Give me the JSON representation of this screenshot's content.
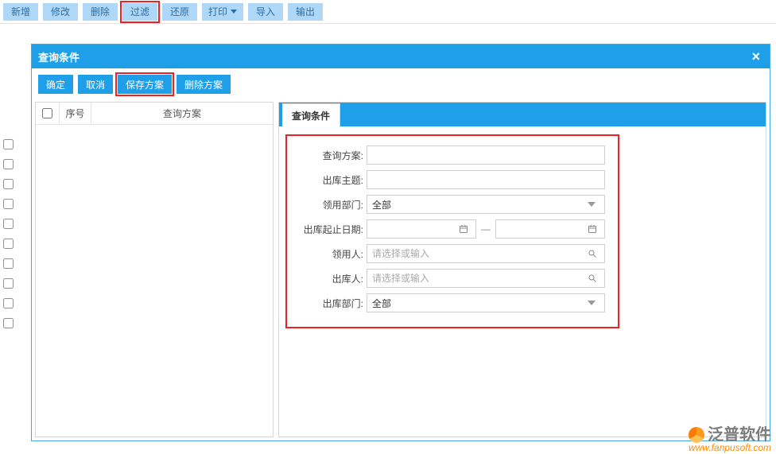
{
  "toolbar": {
    "buttons": [
      {
        "label": "新增",
        "name": "new-button",
        "caret": false,
        "highlight": false
      },
      {
        "label": "修改",
        "name": "edit-button",
        "caret": false,
        "highlight": false
      },
      {
        "label": "删除",
        "name": "delete-button",
        "caret": false,
        "highlight": false
      },
      {
        "label": "过滤",
        "name": "filter-button",
        "caret": false,
        "highlight": true
      },
      {
        "label": "还原",
        "name": "restore-button",
        "caret": false,
        "highlight": false
      },
      {
        "label": "打印",
        "name": "print-button",
        "caret": true,
        "highlight": false
      },
      {
        "label": "导入",
        "name": "import-button",
        "caret": false,
        "highlight": false
      },
      {
        "label": "输出",
        "name": "export-button",
        "caret": false,
        "highlight": false
      }
    ]
  },
  "modal": {
    "title": "查询条件",
    "buttons": [
      {
        "label": "确定",
        "name": "confirm-button",
        "highlight": false
      },
      {
        "label": "取消",
        "name": "cancel-button",
        "highlight": false
      },
      {
        "label": "保存方案",
        "name": "save-plan-button",
        "highlight": true
      },
      {
        "label": "删除方案",
        "name": "delete-plan-button",
        "highlight": false
      }
    ],
    "left": {
      "col_num": "序号",
      "col_plan": "查询方案"
    },
    "right": {
      "tab": "查询条件",
      "fields": {
        "plan_label": "查询方案:",
        "plan_value": "",
        "subject_label": "出库主题:",
        "subject_value": "",
        "recv_dept_label": "领用部门:",
        "recv_dept_value": "全部",
        "date_label": "出库起止日期:",
        "date_from": "",
        "date_sep": "—",
        "date_to": "",
        "collector_label": "领用人:",
        "collector_placeholder": "请选择或输入",
        "issuer_label": "出库人:",
        "issuer_placeholder": "请选择或输入",
        "out_dept_label": "出库部门:",
        "out_dept_value": "全部"
      }
    }
  },
  "branding": {
    "name": "泛普软件",
    "url": "www.fanpusoft.com"
  }
}
